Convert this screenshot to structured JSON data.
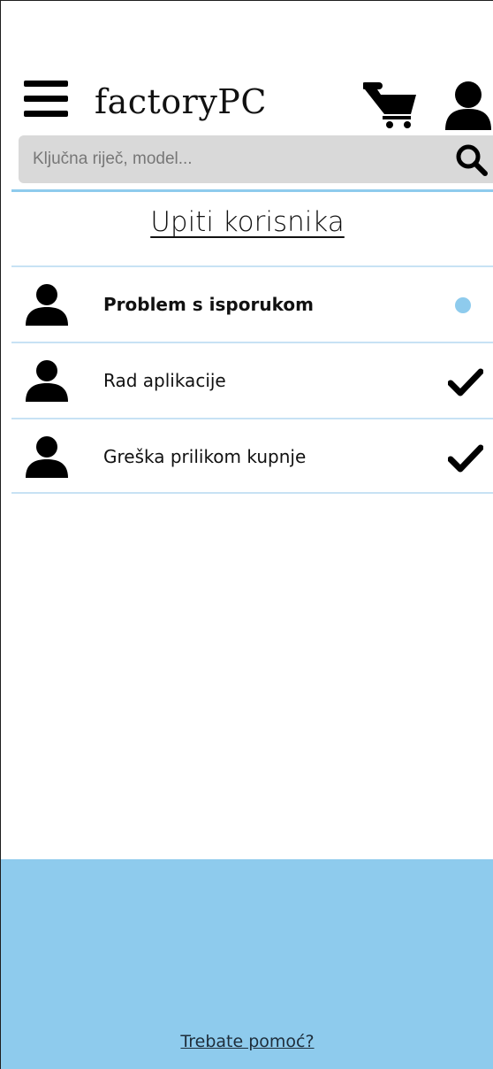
{
  "header": {
    "logo_text": "factoryPC",
    "icons": {
      "menu": "hamburger-menu-icon",
      "cart": "cart-icon",
      "account": "user-icon"
    }
  },
  "search": {
    "placeholder": "Ključna riječ, model...",
    "value": "",
    "icon": "search-icon"
  },
  "main": {
    "title": "Upiti korisnika",
    "inquiries": [
      {
        "subject": "Problem s isporukom",
        "status": "unread",
        "status_icon": "unread-dot-icon",
        "avatar_icon": "user-avatar-icon"
      },
      {
        "subject": "Rad aplikacije",
        "status": "resolved",
        "status_icon": "checkmark-icon",
        "avatar_icon": "user-avatar-icon"
      },
      {
        "subject": "Greška prilikom kupnje",
        "status": "resolved",
        "status_icon": "checkmark-icon",
        "avatar_icon": "user-avatar-icon"
      }
    ]
  },
  "footer": {
    "help_link": "Trebate pomoć?"
  },
  "colors": {
    "accent": "#8ecbed",
    "divider": "#c7e2f4",
    "search_bg": "#d9d9d9",
    "text": "#111111"
  }
}
